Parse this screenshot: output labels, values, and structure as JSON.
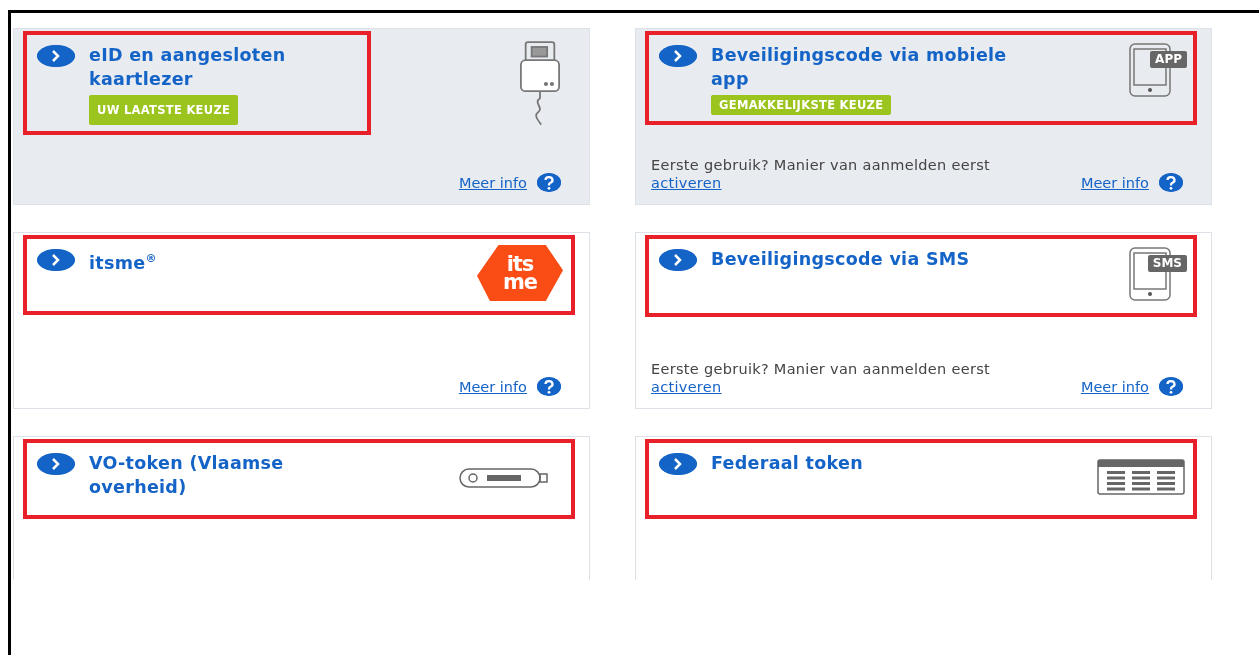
{
  "cards": [
    {
      "title": "eID en aangesloten\nkaartlezer",
      "shaded": true,
      "annotated": true,
      "badge": "UW LAATSTE KEUZE",
      "more_info": "Meer info"
    },
    {
      "title": "Beveiligingscode via mobiele\napp",
      "shaded": true,
      "annotated": true,
      "icon_label": "APP",
      "badge": "GEMAKKELIJKSTE KEUZE",
      "note": "Eerste gebruik? Manier van aanmelden eerst",
      "note_link": "activeren",
      "more_info": "Meer info"
    },
    {
      "title": "itsme$^{®}$",
      "shaded": false,
      "annotated": true,
      "icon_lines": [
        "its",
        "me"
      ],
      "more_info": "Meer info"
    },
    {
      "title": "Beveiligingscode via SMS",
      "shaded": false,
      "annotated": true,
      "icon_label": "SMS",
      "note": "Eerste gebruik? Manier van aanmelden eerst",
      "note_link": "activeren",
      "more_info": "Meer info"
    },
    {
      "title": "VO-token (Vlaamse\noverheid)",
      "shaded": false,
      "annotated": true
    },
    {
      "title": "Federaal token",
      "shaded": false,
      "annotated": true
    }
  ]
}
